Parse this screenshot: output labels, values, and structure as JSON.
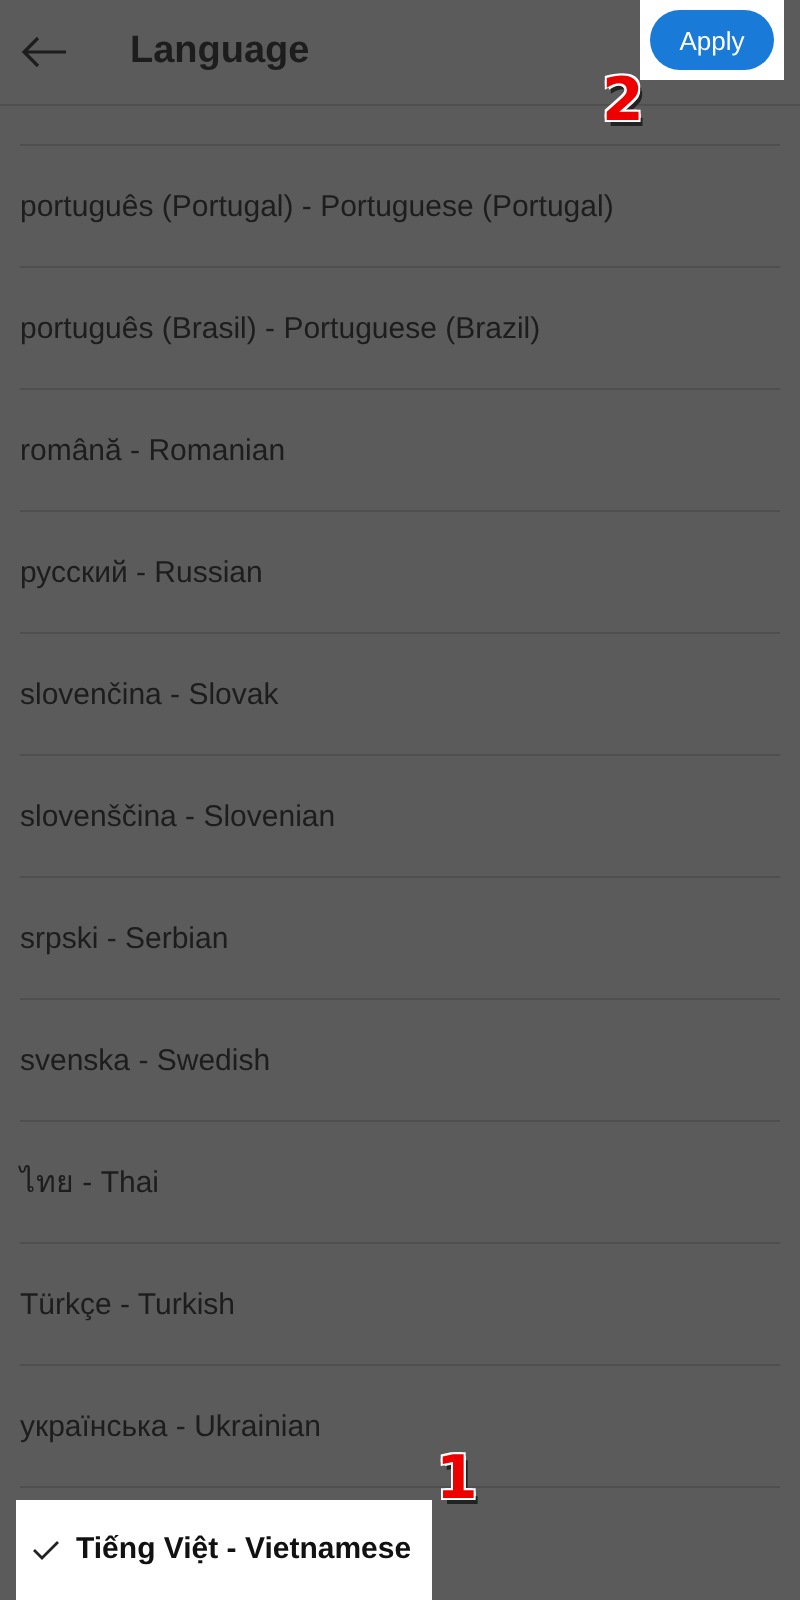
{
  "header": {
    "title": "Language",
    "apply_button": "Apply",
    "apply_step": "2"
  },
  "languages": [
    {
      "label": "português (Portugal) - Portuguese (Portugal)",
      "selected": false
    },
    {
      "label": "português (Brasil) - Portuguese (Brazil)",
      "selected": false
    },
    {
      "label": "română - Romanian",
      "selected": false
    },
    {
      "label": "русский - Russian",
      "selected": false
    },
    {
      "label": "slovenčina - Slovak",
      "selected": false
    },
    {
      "label": "slovenščina - Slovenian",
      "selected": false
    },
    {
      "label": "srpski - Serbian",
      "selected": false
    },
    {
      "label": "svenska - Swedish",
      "selected": false
    },
    {
      "label": "ไทย - Thai",
      "selected": false
    },
    {
      "label": "Türkçe - Turkish",
      "selected": false
    },
    {
      "label": "українська - Ukrainian",
      "selected": false
    },
    {
      "label": "Tiếng Việt - Vietnamese",
      "selected": true,
      "step": "1"
    }
  ]
}
